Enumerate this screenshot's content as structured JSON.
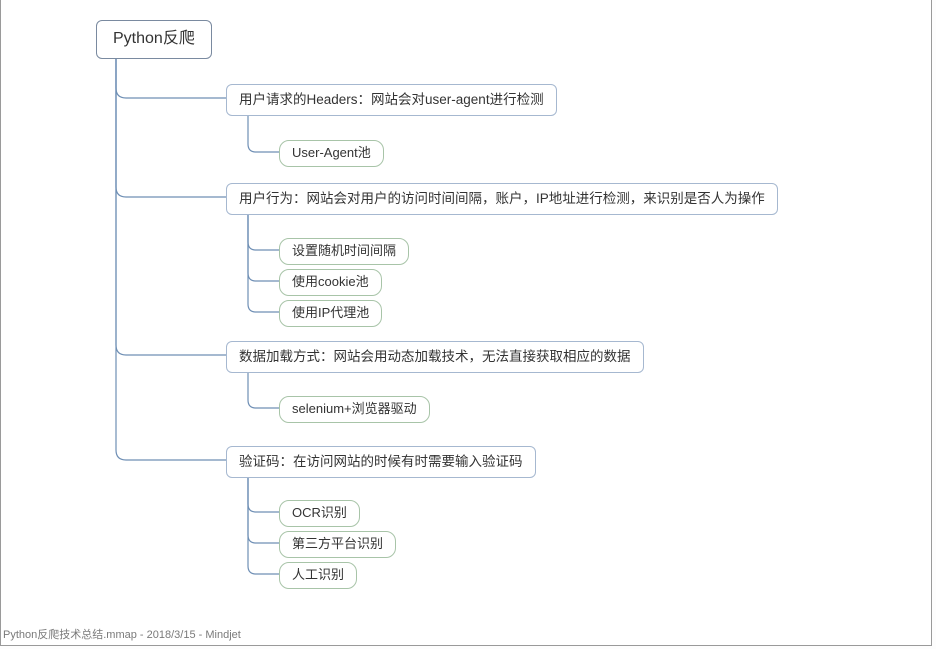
{
  "root": {
    "label": "Python反爬"
  },
  "categories": [
    {
      "label": "用户请求的Headers：网站会对user-agent进行检测",
      "leaves": [
        "User-Agent池"
      ]
    },
    {
      "label": "用户行为：网站会对用户的访问时间间隔，账户，IP地址进行检测，来识别是否人为操作",
      "leaves": [
        "设置随机时间间隔",
        "使用cookie池",
        "使用IP代理池"
      ]
    },
    {
      "label": "数据加载方式：网站会用动态加载技术，无法直接获取相应的数据",
      "leaves": [
        "selenium+浏览器驱动"
      ]
    },
    {
      "label": "验证码：在访问网站的时候有时需要输入验证码",
      "leaves": [
        "OCR识别",
        "第三方平台识别",
        "人工识别"
      ]
    }
  ],
  "footer": "Python反爬技术总结.mmap - 2018/3/15 - Mindjet"
}
